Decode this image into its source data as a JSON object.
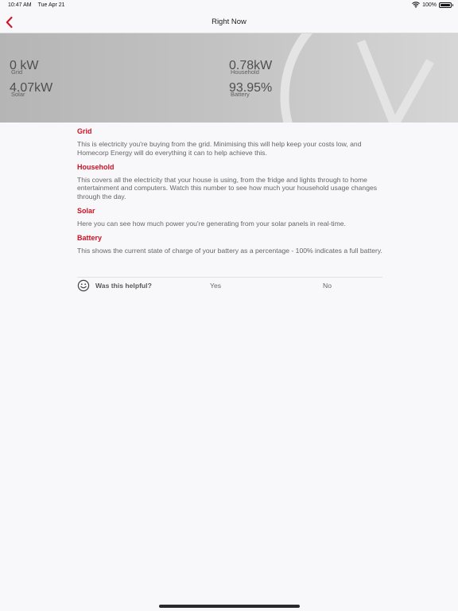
{
  "status_bar": {
    "time": "10:47 AM",
    "date": "Tue Apr 21",
    "battery_text": "100%",
    "battery_level": 1.0
  },
  "nav": {
    "title": "Right Now",
    "back_icon": "chevron-left-icon",
    "accent_color": "#cf1124"
  },
  "metrics": {
    "grid": {
      "value": "0 kW",
      "label": "Grid"
    },
    "household": {
      "value": "0.78kW",
      "label": "Household"
    },
    "solar": {
      "value": "4.07kW",
      "label": "Solar"
    },
    "battery": {
      "value": "93.95%",
      "label": "Battery"
    }
  },
  "sections": [
    {
      "title": "Grid",
      "text": "This is electricity you're buying from the grid. Minimising this will help keep your costs low, and Homecorp Energy will do everything it can to help achieve this."
    },
    {
      "title": "Household",
      "text": "This covers all the electricity that your house is using, from the fridge and lights through to home entertainment and computers. Watch this number to see how much your household usage changes through the day."
    },
    {
      "title": "Solar",
      "text": "Here you can see how much power you're generating from your solar panels in real-time."
    },
    {
      "title": "Battery",
      "text": "This shows the current state of charge of your battery as a percentage - 100% indicates a full battery."
    }
  ],
  "feedback": {
    "question": "Was this helpful?",
    "yes_label": "Yes",
    "no_label": "No",
    "icon": "smile-icon"
  }
}
